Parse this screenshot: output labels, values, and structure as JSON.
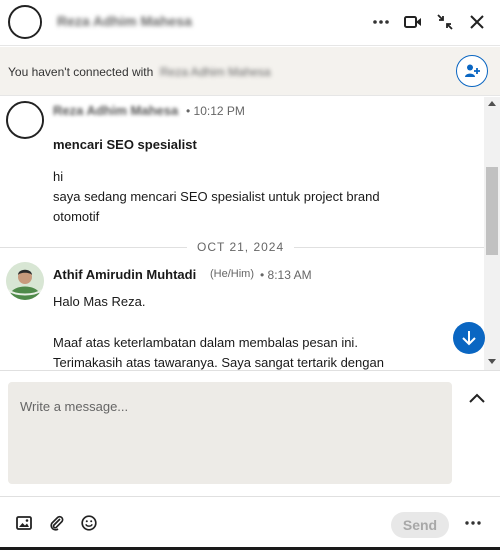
{
  "header": {
    "contact_name": "Reza Adhim Mahesa",
    "more_icon": "more-horizontal-icon",
    "video_icon": "video-call-icon",
    "minimize_icon": "minimize-icon",
    "close_icon": "close-icon"
  },
  "banner": {
    "text": "You haven't connected with",
    "blurred_name": "Reza Adhim Mahesa",
    "connect_icon": "add-person-icon"
  },
  "messages": [
    {
      "sender": "Reza Adhim Mahesa",
      "time": "10:12 PM",
      "subject": "mencari SEO spesialist",
      "lines": [
        "hi",
        "saya sedang mencari SEO spesialist untuk project brand",
        "otomotif"
      ]
    },
    {
      "date_separator": "OCT 21, 2024",
      "sender": "Athif Amirudin Muhtadi",
      "pronoun": "(He/Him)",
      "time": "8:13 AM",
      "lines": [
        "Halo Mas Reza.",
        "Maaf atas keterlambatan dalam membalas pesan ini.",
        "Terimakasih atas tawaranya. Saya sangat tertarik dengan"
      ]
    }
  ],
  "compose": {
    "placeholder": "Write a message..."
  },
  "footer": {
    "send_label": "Send",
    "image_icon": "image-icon",
    "attach_icon": "paperclip-icon",
    "emoji_icon": "emoji-icon",
    "more_icon": "more-horizontal-icon"
  },
  "colors": {
    "accent": "#0a66c2",
    "compose_bg": "#edebe7",
    "banner_bg": "#f4f2ee"
  }
}
